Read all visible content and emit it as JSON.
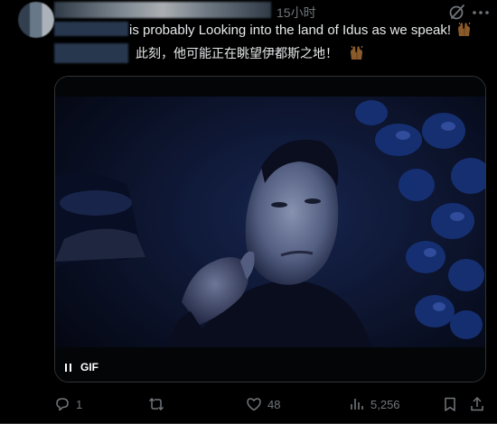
{
  "post": {
    "timestamp": "15小时",
    "text_en": "is probably Looking into the land of Idus as we speak!",
    "text_zh": "此刻，他可能正在眺望伊都斯之地！",
    "media_badge": "GIF",
    "icons": {
      "grok": "grok-icon",
      "more": "more-icon",
      "emoji": "raising-hands-emoji",
      "pause": "pause-icon"
    }
  },
  "actions": {
    "replies": "1",
    "retweets": "",
    "likes": "48",
    "views": "5,256"
  },
  "colors": {
    "background": "#000000",
    "text": "#e7e9ea",
    "muted": "#71767b",
    "border": "#2f3336"
  }
}
